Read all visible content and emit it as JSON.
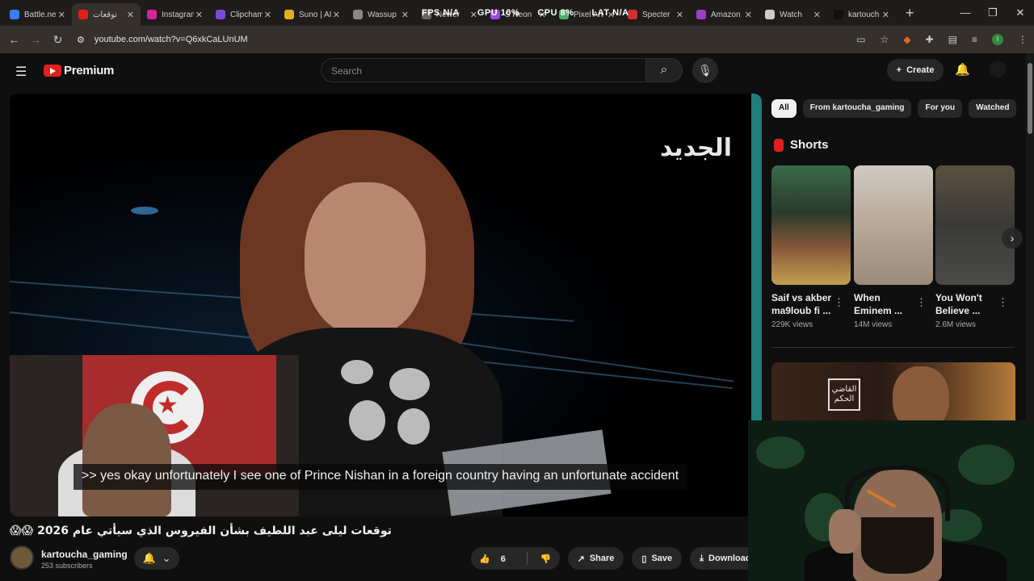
{
  "browser": {
    "tabs": [
      {
        "label": "Battle.net",
        "color": "#3b7cff",
        "active": false
      },
      {
        "label": "توقعات",
        "color": "#e02020",
        "active": true
      },
      {
        "label": "Instagram",
        "color": "#d6249f",
        "active": false
      },
      {
        "label": "Clipchamp",
        "color": "#7b4bd6",
        "active": false
      },
      {
        "label": "Suno | AI",
        "color": "#e0b020",
        "active": false
      },
      {
        "label": "Wassup",
        "color": "#888888",
        "active": false
      },
      {
        "label": "Newer",
        "color": "#666666",
        "active": false
      },
      {
        "label": "S Neon",
        "color": "#9a4be0",
        "active": false
      },
      {
        "label": "Pixel Art",
        "color": "#4bb06a",
        "active": false
      },
      {
        "label": "Specter",
        "color": "#d03030",
        "active": false
      },
      {
        "label": "Amazon",
        "color": "#9a40c0",
        "active": false
      },
      {
        "label": "Watch",
        "color": "#cccccc",
        "active": false
      },
      {
        "label": "kartouch",
        "color": "#111111",
        "active": false
      }
    ],
    "url": "youtube.com/watch?v=Q6xkCaLUnUM",
    "stats": [
      "FPS  N/A",
      "GPU  10%",
      "CPU  8%",
      "LAT  N/A"
    ]
  },
  "header": {
    "logo_text": "Premium",
    "search_placeholder": "Search",
    "create_label": "Create"
  },
  "video": {
    "subtitle": ">> yes okay unfortunately I see one of Prince Nishan in a foreign country having an unfortunate accident",
    "channel_logo": "الجديد",
    "title": "توقعات ليلى عبد اللطيف بشأن الفيروس الذي سيأتي عام 2026 😱😱",
    "channel_name": "kartoucha_gaming",
    "subscribers": "253 subscribers",
    "likes": "6",
    "share_label": "Share",
    "save_label": "Save",
    "download_label": "Download"
  },
  "sidebar": {
    "chips": [
      "All",
      "From kartoucha_gaming",
      "For you",
      "Watched"
    ],
    "shorts_title": "Shorts",
    "shorts": [
      {
        "title": "Saif vs akber ma9loub fi ...",
        "views": "229K views"
      },
      {
        "title": "When Eminem ...",
        "views": "14M views"
      },
      {
        "title": "You Won't Believe ...",
        "views": "2.6M views"
      }
    ],
    "rec_logo_text": "القاضي الحكم"
  }
}
